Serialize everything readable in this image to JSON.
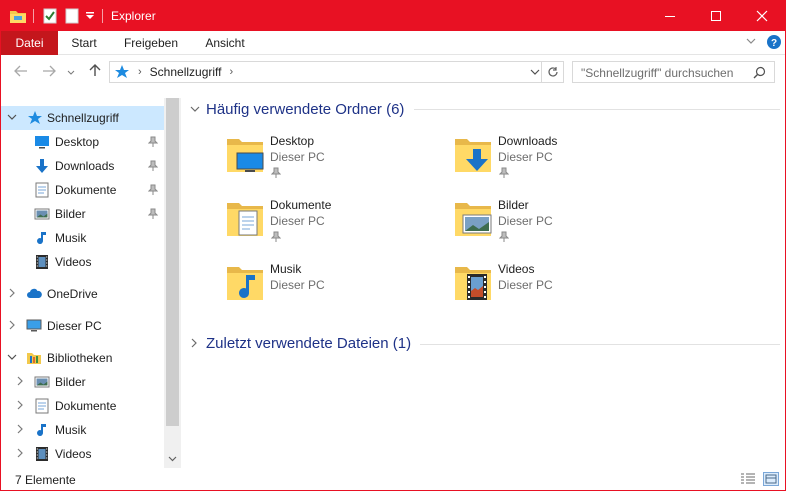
{
  "window": {
    "title": "Explorer",
    "accent": "#e81123"
  },
  "titlebar": {
    "minimize_icon": "minimize-icon",
    "maximize_icon": "maximize-icon",
    "close_icon": "close-icon"
  },
  "ribbon": {
    "tabs": [
      {
        "label": "Datei"
      },
      {
        "label": "Start"
      },
      {
        "label": "Freigeben"
      },
      {
        "label": "Ansicht"
      }
    ]
  },
  "address": {
    "path": "Schnellzugriff",
    "search_placeholder": "\"Schnellzugriff\" durchsuchen"
  },
  "sidebar": {
    "items": [
      {
        "label": "Schnellzugriff",
        "icon": "star-icon"
      },
      {
        "label": "Desktop",
        "icon": "desktop-icon"
      },
      {
        "label": "Downloads",
        "icon": "download-icon"
      },
      {
        "label": "Dokumente",
        "icon": "document-icon"
      },
      {
        "label": "Bilder",
        "icon": "pictures-icon"
      },
      {
        "label": "Musik",
        "icon": "music-icon"
      },
      {
        "label": "Videos",
        "icon": "videos-icon"
      },
      {
        "label": "OneDrive",
        "icon": "cloud-icon"
      },
      {
        "label": "Dieser PC",
        "icon": "computer-icon"
      },
      {
        "label": "Bibliotheken",
        "icon": "library-icon"
      },
      {
        "label": "Bilder",
        "icon": "pictures-icon"
      },
      {
        "label": "Dokumente",
        "icon": "document-icon"
      },
      {
        "label": "Musik",
        "icon": "music-icon"
      },
      {
        "label": "Videos",
        "icon": "videos-icon"
      }
    ]
  },
  "content": {
    "frequent_header": "Häufig verwendete Ordner (6)",
    "recent_header": "Zuletzt verwendete Dateien (1)",
    "folders": [
      {
        "name": "Desktop",
        "location": "Dieser PC",
        "overlay": "desktop-icon"
      },
      {
        "name": "Downloads",
        "location": "Dieser PC",
        "overlay": "download-icon"
      },
      {
        "name": "Dokumente",
        "location": "Dieser PC",
        "overlay": "document-icon"
      },
      {
        "name": "Bilder",
        "location": "Dieser PC",
        "overlay": "pictures-icon"
      },
      {
        "name": "Musik",
        "location": "Dieser PC",
        "overlay": "music-icon"
      },
      {
        "name": "Videos",
        "location": "Dieser PC",
        "overlay": "videos-icon"
      }
    ]
  },
  "status": {
    "count": "7 Elemente"
  }
}
